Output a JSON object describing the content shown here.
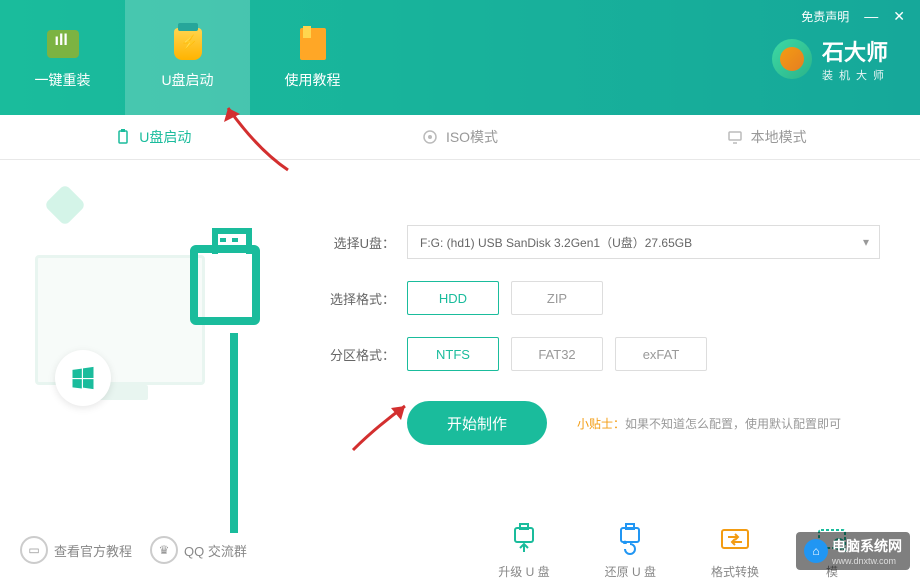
{
  "header": {
    "disclaimer": "免责声明",
    "brand_title": "石大师",
    "brand_sub": "装机大师",
    "tabs": [
      {
        "label": "一键重装"
      },
      {
        "label": "U盘启动"
      },
      {
        "label": "使用教程"
      }
    ]
  },
  "sub_tabs": [
    {
      "label": "U盘启动"
    },
    {
      "label": "ISO模式"
    },
    {
      "label": "本地模式"
    }
  ],
  "form": {
    "disk_label": "选择U盘：",
    "disk_value": "F:G: (hd1)  USB SanDisk 3.2Gen1（U盘）27.65GB",
    "format_label": "选择格式：",
    "format_options": [
      "HDD",
      "ZIP"
    ],
    "partition_label": "分区格式：",
    "partition_options": [
      "NTFS",
      "FAT32",
      "exFAT"
    ],
    "primary_btn": "开始制作",
    "tip_label": "小贴士：",
    "tip_text": "如果不知道怎么配置，使用默认配置即可"
  },
  "bottom": {
    "links": [
      "查看官方教程",
      "QQ 交流群"
    ],
    "actions": [
      "升级 U 盘",
      "还原 U 盘",
      "格式转换",
      "模"
    ]
  },
  "watermark": {
    "title": "电脑系统网",
    "sub": "www.dnxtw.com"
  }
}
